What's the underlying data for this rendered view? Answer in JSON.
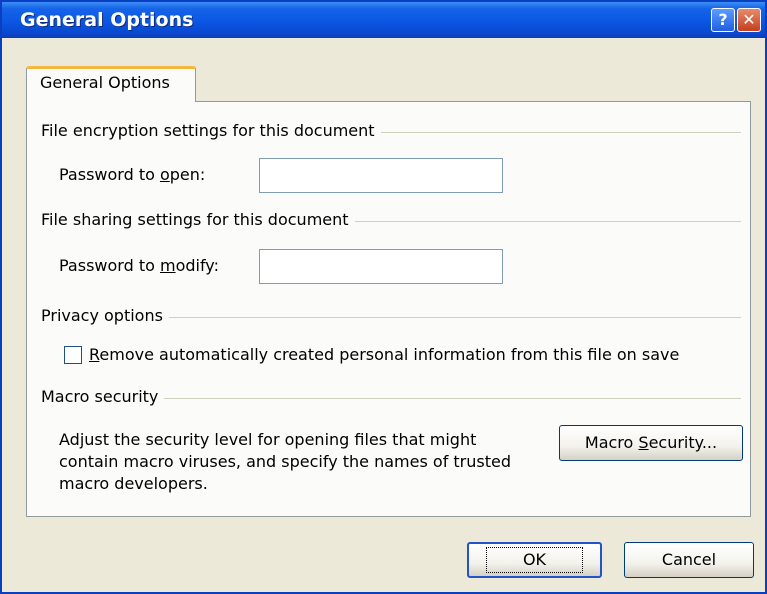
{
  "window": {
    "title": "General Options",
    "help_glyph": "?",
    "close_glyph": "✕"
  },
  "tab": {
    "label": "General Options"
  },
  "encryption": {
    "title": "File encryption settings for this document",
    "password_label_pre": "Password to ",
    "password_label_mnemonic": "o",
    "password_label_post": "pen:",
    "password_value": ""
  },
  "sharing": {
    "title": "File sharing settings for this document",
    "password_label_pre": "Password to ",
    "password_label_mnemonic": "m",
    "password_label_post": "odify:",
    "password_value": ""
  },
  "privacy": {
    "title": "Privacy options",
    "checkbox_checked": false,
    "checkbox_mnemonic": "R",
    "checkbox_label_post": "emove automatically created personal information from this file on save"
  },
  "macro": {
    "title": "Macro security",
    "description": "Adjust the security level for opening files that might contain macro viruses, and specify the names of trusted macro developers.",
    "button_pre": "Macro ",
    "button_mnemonic": "S",
    "button_post": "ecurity..."
  },
  "footer": {
    "ok_label": "OK",
    "cancel_label": "Cancel"
  }
}
